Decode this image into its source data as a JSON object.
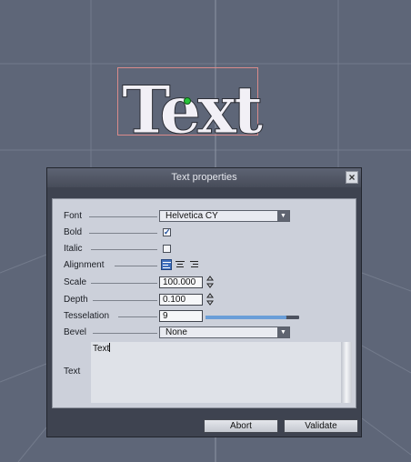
{
  "viewport": {
    "preview_text": "Text"
  },
  "dialog": {
    "title": "Text properties",
    "close_icon": "close-icon",
    "fields": {
      "font": {
        "label": "Font",
        "value": "Helvetica CY"
      },
      "bold": {
        "label": "Bold",
        "checked": true
      },
      "italic": {
        "label": "Italic",
        "checked": false
      },
      "alignment": {
        "label": "Alignment",
        "options": [
          "align-left-icon",
          "align-center-icon",
          "align-right-icon"
        ],
        "selected": "left"
      },
      "scale": {
        "label": "Scale",
        "value": "100.000"
      },
      "depth": {
        "label": "Depth",
        "value": "0.100"
      },
      "tesselation": {
        "label": "Tesselation",
        "value": "9",
        "slider_fraction": 0.86
      },
      "bevel": {
        "label": "Bevel",
        "value": "None"
      },
      "text": {
        "label": "Text",
        "value": "Text"
      }
    },
    "buttons": {
      "abort": "Abort",
      "validate": "Validate"
    }
  },
  "colors": {
    "viewport_bg": "#5e6678",
    "accent": "#3f6fbd",
    "pivot": "#27c43a"
  }
}
